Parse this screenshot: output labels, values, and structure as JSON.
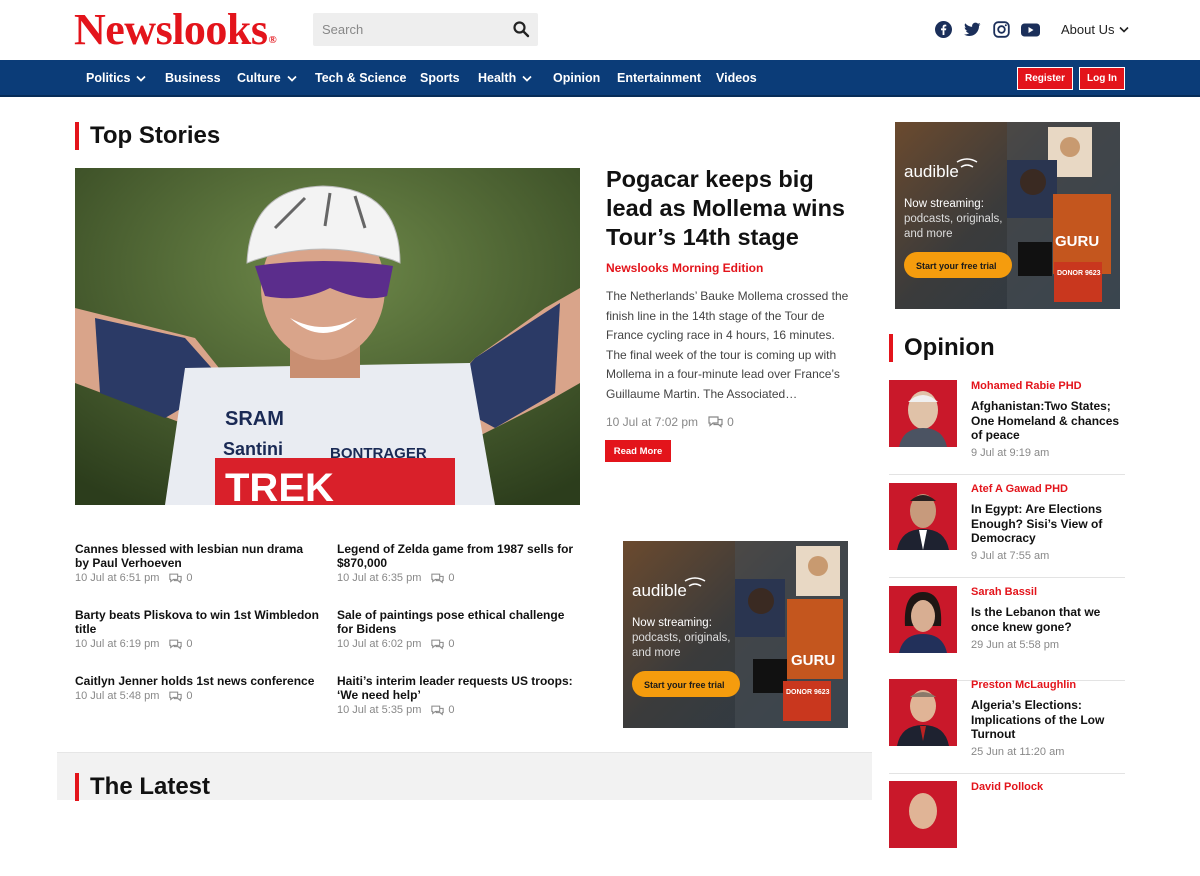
{
  "header": {
    "logo": "Newslooks",
    "logo_mark": "®",
    "search_placeholder": "Search",
    "social": [
      "facebook-icon",
      "twitter-icon",
      "instagram-icon",
      "youtube-icon"
    ],
    "about_label": "About Us"
  },
  "nav": {
    "items": [
      {
        "label": "Politics",
        "dropdown": true
      },
      {
        "label": "Business",
        "dropdown": false
      },
      {
        "label": "Culture",
        "dropdown": true
      },
      {
        "label": "Tech & Science",
        "dropdown": false
      },
      {
        "label": "Sports",
        "dropdown": false
      },
      {
        "label": "Health",
        "dropdown": true
      },
      {
        "label": "Opinion",
        "dropdown": false
      },
      {
        "label": "Entertainment",
        "dropdown": false
      },
      {
        "label": "Videos",
        "dropdown": false
      }
    ],
    "register_label": "Register",
    "login_label": "Log In"
  },
  "top_stories": {
    "title": "Top Stories",
    "hero": {
      "headline": "Pogacar keeps big lead as Mollema wins Tour’s 14th stage",
      "edition": "Newslooks Morning Edition",
      "excerpt": "The Netherlands’ Bauke Mollema crossed the finish line in the 14th stage of the Tour de France cycling race in 4 hours, 16 minutes. The final week of the tour is coming up with Mollema in a four-minute lead over France’s Guillaume Martin. The Associated…",
      "date": "10 Jul at 7:02 pm",
      "comments": "0",
      "read_more": "Read More",
      "jersey_text": [
        "SRAM",
        "Santini",
        "BONTRAGER",
        "TREK"
      ]
    },
    "stories": [
      {
        "title": "Cannes blessed with lesbian nun drama by Paul Verhoeven",
        "date": "10 Jul at 6:51 pm",
        "comments": "0"
      },
      {
        "title": "Legend of Zelda game from 1987 sells for $870,000",
        "date": "10 Jul at 6:35 pm",
        "comments": "0"
      },
      {
        "title": "Barty beats Pliskova to win 1st Wimbledon title",
        "date": "10 Jul at 6:19 pm",
        "comments": "0"
      },
      {
        "title": "Sale of paintings pose ethical challenge for Bidens",
        "date": "10 Jul at 6:02 pm",
        "comments": "0"
      },
      {
        "title": "Caitlyn Jenner holds 1st news conference",
        "date": "10 Jul at 5:48 pm",
        "comments": "0"
      },
      {
        "title": "Haiti’s interim leader requests US troops: ‘We need help’",
        "date": "10 Jul at 5:35 pm",
        "comments": "0"
      }
    ]
  },
  "ad": {
    "brand": "audible",
    "line1": "Now streaming:",
    "line2": "podcasts, originals,",
    "line3": "and more",
    "cta": "Start your free trial",
    "tile_guru": "GURU",
    "tile_donor": "DONOR 9623"
  },
  "opinion": {
    "title": "Opinion",
    "items": [
      {
        "author": "Mohamed Rabie PHD",
        "title": "Afghanistan:Two States; One Homeland & chances of peace",
        "date": "9 Jul at 9:19 am"
      },
      {
        "author": "Atef A Gawad PHD",
        "title": "In Egypt: Are Elections Enough? Sisi’s View of Democracy",
        "date": "9 Jul at 7:55 am"
      },
      {
        "author": "Sarah Bassil",
        "title": "Is the Lebanon that we once knew gone?",
        "date": "29 Jun at 5:58 pm"
      },
      {
        "author": "Preston McLaughlin",
        "title": "Algeria’s Elections: Implications of the Low Turnout",
        "date": "25 Jun at 11:20 am"
      },
      {
        "author": "David Pollock",
        "title": "",
        "date": ""
      }
    ]
  },
  "latest": {
    "title": "The Latest"
  },
  "colors": {
    "brand_red": "#e3141b",
    "nav_blue": "#0b3c78"
  }
}
